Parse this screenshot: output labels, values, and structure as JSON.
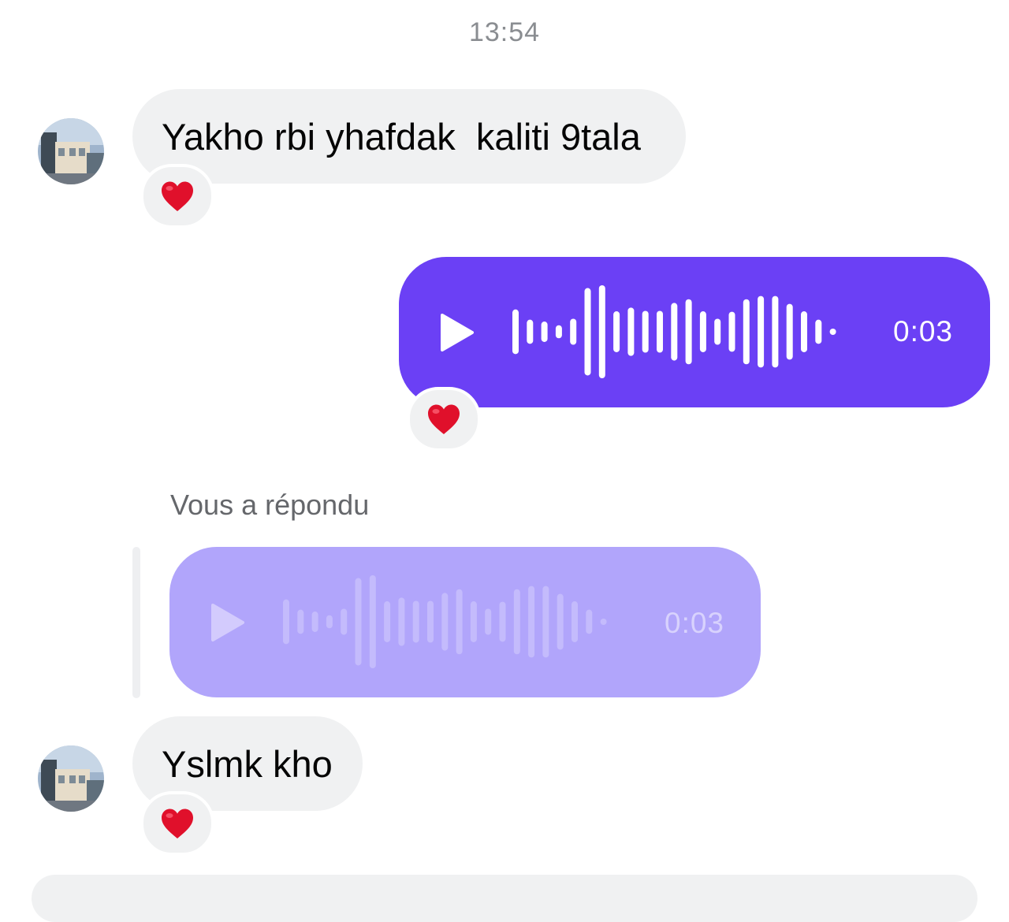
{
  "thread": {
    "timestamp": "13:54",
    "messages": [
      {
        "type": "text",
        "direction": "incoming",
        "text": "Yakho rbi yhafdak  kaliti 9tala",
        "reaction": "heart"
      },
      {
        "type": "voice",
        "direction": "outgoing",
        "duration": "0:03",
        "reaction": "heart"
      },
      {
        "type": "reply-context",
        "label": "Vous a répondu",
        "quoted": {
          "type": "voice",
          "duration": "0:03"
        }
      },
      {
        "type": "text",
        "direction": "incoming",
        "text": "Yslmk kho",
        "reaction": "heart"
      }
    ]
  },
  "colors": {
    "outgoing_bubble": "#6b40f5",
    "quoted_bubble": "#b1a5fb",
    "incoming_bubble": "#f0f1f2",
    "timestamp_text": "#8a8d91",
    "reaction_heart": "#e0102b"
  },
  "icons": {
    "avatar": "contact-avatar-photo",
    "play": "play-icon",
    "reaction": "heart-icon",
    "waveform": "audio-waveform"
  },
  "waveform_levels": [
    0.48,
    0.26,
    0.22,
    0.14,
    0.28,
    0.94,
    1.0,
    0.44,
    0.52,
    0.45,
    0.45,
    0.62,
    0.7,
    0.44,
    0.28,
    0.43,
    0.7,
    0.77,
    0.77,
    0.6,
    0.44,
    0.26
  ]
}
